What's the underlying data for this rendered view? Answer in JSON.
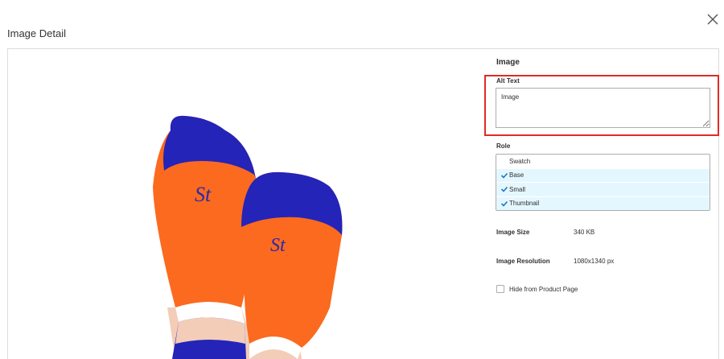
{
  "modal": {
    "title": "Image Detail",
    "close_icon": "close-icon"
  },
  "image": {
    "description_icon": "sock-product-image",
    "colors": {
      "sock_body": "#fb6a1f",
      "sock_toe": "#2424b8",
      "rib": "#ffffff",
      "logo": "#2b2aa8",
      "skin": "#f3cdb8"
    }
  },
  "side": {
    "section_title": "Image",
    "alt_text": {
      "label": "Alt Text",
      "value": "Image"
    },
    "role": {
      "label": "Role",
      "items": [
        {
          "label": "Swatch",
          "selected": false
        },
        {
          "label": "Base",
          "selected": true
        },
        {
          "label": "Small",
          "selected": true
        },
        {
          "label": "Thumbnail",
          "selected": true
        }
      ]
    },
    "image_size": {
      "label": "Image Size",
      "value": "340 KB"
    },
    "image_resolution": {
      "label": "Image Resolution",
      "value": "1080x1340 px"
    },
    "hide_from_product_page": {
      "label": "Hide from Product Page",
      "checked": false
    }
  },
  "colors": {
    "highlight_border": "#e02b27",
    "selected_bg": "#e5f7fe",
    "check": "#1979c3"
  }
}
